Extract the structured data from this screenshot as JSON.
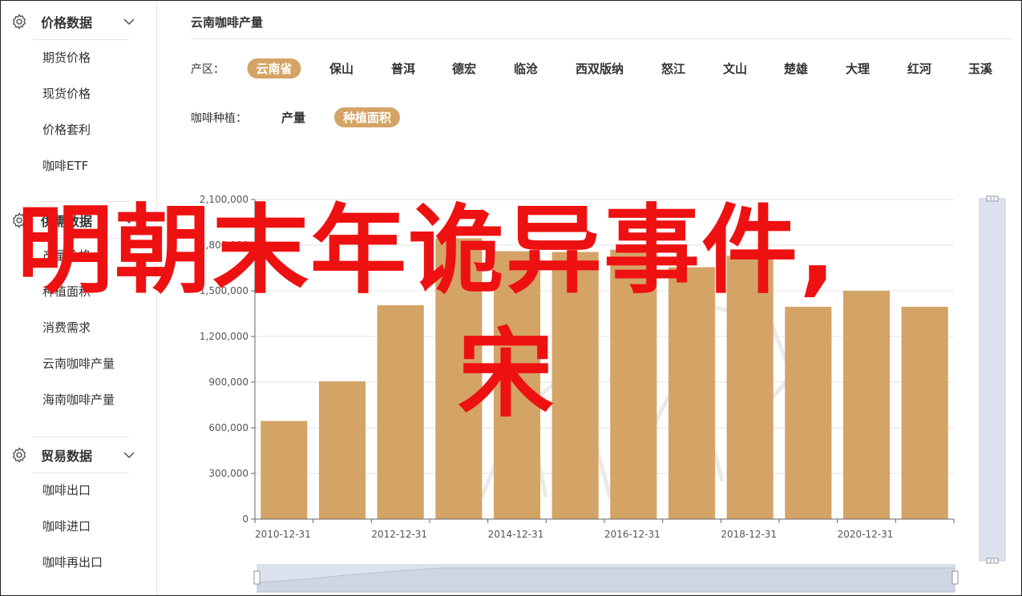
{
  "sidebar": {
    "sections": [
      {
        "title": "价格数据",
        "icon": "gear-icon",
        "items": [
          "期货价格",
          "现货价格",
          "价格套利",
          "咖啡ETF"
        ]
      },
      {
        "title": "供需数据",
        "icon": "gear-icon",
        "items": [
          "产量价格",
          "种植面积",
          "消费需求",
          "云南咖啡产量",
          "海南咖啡产量"
        ]
      },
      {
        "title": "贸易数据",
        "icon": "gear-icon",
        "items": [
          "咖啡出口",
          "咖啡进口",
          "咖啡再出口"
        ]
      }
    ]
  },
  "main": {
    "title": "云南咖啡产量",
    "region_label": "产区：",
    "regions": [
      "云南省",
      "保山",
      "普洱",
      "德宏",
      "临沧",
      "西双版纳",
      "怒江",
      "文山",
      "楚雄",
      "大理",
      "红河",
      "玉溪"
    ],
    "region_selected": "云南省",
    "type_label": "咖啡种植：",
    "types": [
      "产量",
      "种植面积"
    ],
    "type_selected": "种植面积"
  },
  "overlay": {
    "line1": "明朝末年诡异事件,",
    "line2": "宋"
  },
  "colors": {
    "accent": "#d4a466",
    "bar": "#d4a466",
    "overlay_text": "#ee1111",
    "zoom_fill": "#dde3ee"
  },
  "chart_data": {
    "type": "bar",
    "x": [
      "2010-12-31",
      "2011-12-31",
      "2012-12-31",
      "2013-12-31",
      "2014-12-31",
      "2015-12-31",
      "2016-12-31",
      "2017-12-31",
      "2018-12-31",
      "2019-12-31",
      "2020-12-31",
      "2021-12-31"
    ],
    "values": [
      645000,
      905000,
      1405000,
      1845000,
      1760000,
      1755000,
      1770000,
      1655000,
      1730000,
      1395000,
      1500000,
      1395000
    ],
    "x_tick_labels": [
      "2010-12-31",
      "2012-12-31",
      "2014-12-31",
      "2016-12-31",
      "2018-12-31",
      "2020-12-31"
    ],
    "y_ticks": [
      0,
      300000,
      600000,
      900000,
      1200000,
      1500000,
      1800000,
      2100000
    ],
    "y_tick_labels": [
      "0",
      "300,000",
      "600,000",
      "900,000",
      "1,200,000",
      "1,500,000",
      "1,800,000",
      "2,100,000"
    ],
    "ylim": [
      0,
      2100000
    ],
    "grid": true,
    "title": "",
    "xlabel": "",
    "ylabel": ""
  }
}
